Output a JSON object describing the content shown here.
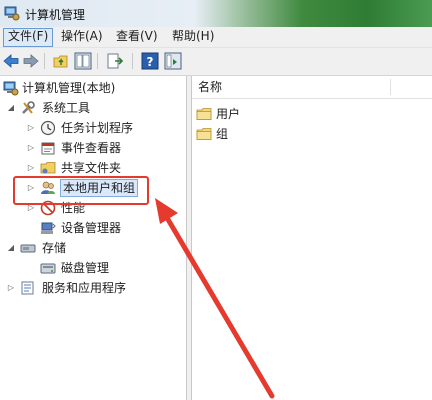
{
  "window": {
    "title": "计算机管理"
  },
  "menu": [
    {
      "label": "文件(F)",
      "active": true
    },
    {
      "label": "操作(A)",
      "active": false
    },
    {
      "label": "查看(V)",
      "active": false
    },
    {
      "label": "帮助(H)",
      "active": false
    }
  ],
  "toolbar": {
    "buttons": [
      "back-arrow-icon",
      "forward-arrow-icon",
      "up-folder-icon",
      "show-hide-tree-icon",
      "export-list-icon",
      "help-icon",
      "properties-icon"
    ]
  },
  "tree": {
    "root": {
      "label": "计算机管理(本地)"
    },
    "system_tools": {
      "label": "系统工具"
    },
    "task_scheduler": {
      "label": "任务计划程序"
    },
    "event_viewer": {
      "label": "事件查看器"
    },
    "shared_folders": {
      "label": "共享文件夹"
    },
    "local_users_groups": {
      "label": "本地用户和组"
    },
    "performance": {
      "label": "性能"
    },
    "device_manager": {
      "label": "设备管理器"
    },
    "storage": {
      "label": "存储"
    },
    "disk_management": {
      "label": "磁盘管理"
    },
    "services_apps": {
      "label": "服务和应用程序"
    }
  },
  "list": {
    "header": {
      "name": "名称"
    },
    "items": [
      {
        "label": "用户"
      },
      {
        "label": "组"
      }
    ]
  },
  "colors": {
    "annotation": "#e53a2e",
    "selection": "#d9e8fb",
    "menu_highlight": "#dce9f7"
  }
}
